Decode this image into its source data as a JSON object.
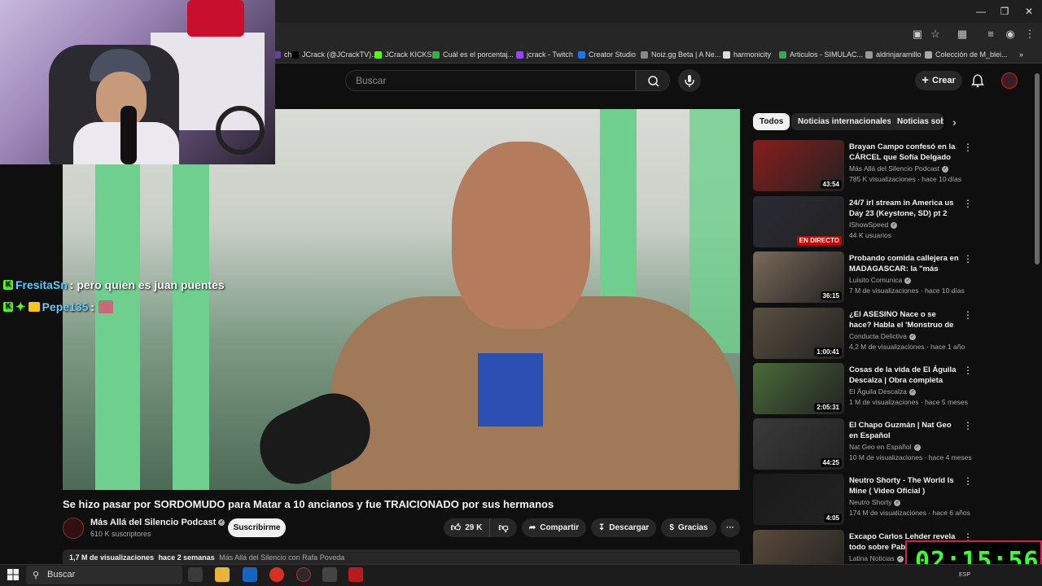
{
  "browser": {
    "bookmarks": [
      {
        "label": "ch",
        "color": "#6441a5"
      },
      {
        "label": "JCrack (@JCrackTV)...",
        "color": "#000000"
      },
      {
        "label": "JCrack KICKS",
        "color": "#53fc18"
      },
      {
        "label": "Cuál es el porcentaj...",
        "color": "#2fb344"
      },
      {
        "label": "jcrack - Twitch",
        "color": "#9146ff"
      },
      {
        "label": "Creator Studio",
        "color": "#1877f2"
      },
      {
        "label": "Noiz.gg Beta | A Ne...",
        "color": "#888888"
      },
      {
        "label": "harmonicity",
        "color": "#dddddd"
      },
      {
        "label": "Articulos - SIMULAC...",
        "color": "#34a853"
      },
      {
        "label": "aldrinjaramillo",
        "color": "#999999"
      },
      {
        "label": "Colección de M_blei...",
        "color": "#aaaaaa"
      }
    ],
    "more_bookmarks": "»"
  },
  "youtube": {
    "search_placeholder": "Buscar",
    "create_label": "Crear"
  },
  "chat": [
    {
      "user": "FresitaSn",
      "message": ": pero quien es juan puentes"
    },
    {
      "user": "Pepe135",
      "message": ":"
    }
  ],
  "video": {
    "title": "Se hizo pasar por SORDOMUDO para Matar a 10 ancianos y fue TRAICIONADO por sus hermanos",
    "channel": "Más Allá del Silencio Podcast",
    "subscribers": "610 K suscriptores",
    "subscribe_label": "Suscribirme",
    "likes": "29 K",
    "share_label": "Compartir",
    "download_label": "Descargar",
    "thanks_label": "Gracias",
    "more_label": "···",
    "views": "1,7 M de visualizaciones",
    "age": "hace 2 semanas",
    "description_preview": "Más Allá del Silencio con Rafa Poveda"
  },
  "chips": [
    {
      "label": "Todos",
      "active": true
    },
    {
      "label": "Noticias internacionales",
      "active": false
    },
    {
      "label": "Noticias sobre",
      "active": false
    }
  ],
  "recommendations": [
    {
      "title": "Brayan Campo confesó en la CÁRCEL que Sofía Delgado N...",
      "channel": "Más Allá del Silencio Podcast",
      "meta": "785 K visualizaciones · hace 10 días",
      "duration": "43:54",
      "thumb_color": "#8a1c1c"
    },
    {
      "title": "24/7 irl stream in America us Day 23 (Keystone, SD) pt 2",
      "channel": "IShowSpeed",
      "meta": "44 K usuarios",
      "duration": "EN DIRECTO",
      "thumb_color": "#2a2a35"
    },
    {
      "title": "Probando comida callejera en MADAGASCAR: la \"más barata...",
      "channel": "Luisito Comunica",
      "meta": "7 M de visualizaciones · hace 10 días",
      "duration": "36:15",
      "thumb_color": "#7a6a5a"
    },
    {
      "title": "¿El ASESINO Nace o se hace? Habla el 'Monstruo de Guarne'",
      "channel": "Conducta Delictiva",
      "meta": "4,2 M de visualizaciones · hace 1 año",
      "duration": "1:00:41",
      "thumb_color": "#5a5040"
    },
    {
      "title": "Cosas de la vida de El Águila Descalza | Obra completa",
      "channel": "El Águila Descalza",
      "meta": "1 M de visualizaciones · hace 5 meses",
      "duration": "2:05:31",
      "thumb_color": "#4a6a3a"
    },
    {
      "title": "El Chapo Guzmán | Nat Geo en Español",
      "channel": "Nat Geo en Español",
      "meta": "10 M de visualizaciones · hace 4 meses",
      "duration": "44:25",
      "thumb_color": "#3a3a3a"
    },
    {
      "title": "Neutro Shorty - The World Is Mine ( Video Oficial )",
      "channel": "Neutro Shorty",
      "meta": "174 M de visualizaciones · hace 6 años",
      "duration": "4:05",
      "thumb_color": "#1a1a1a"
    },
    {
      "title": "Excapo Carlos Lehder revela todo sobre Pablo Escobar y el...",
      "channel": "Latina Noticias",
      "meta": "",
      "duration": "",
      "thumb_color": "#5a4a3a"
    }
  ],
  "timer": "02:15:56",
  "taskbar": {
    "search_label": "Buscar",
    "tray": "ESP"
  }
}
